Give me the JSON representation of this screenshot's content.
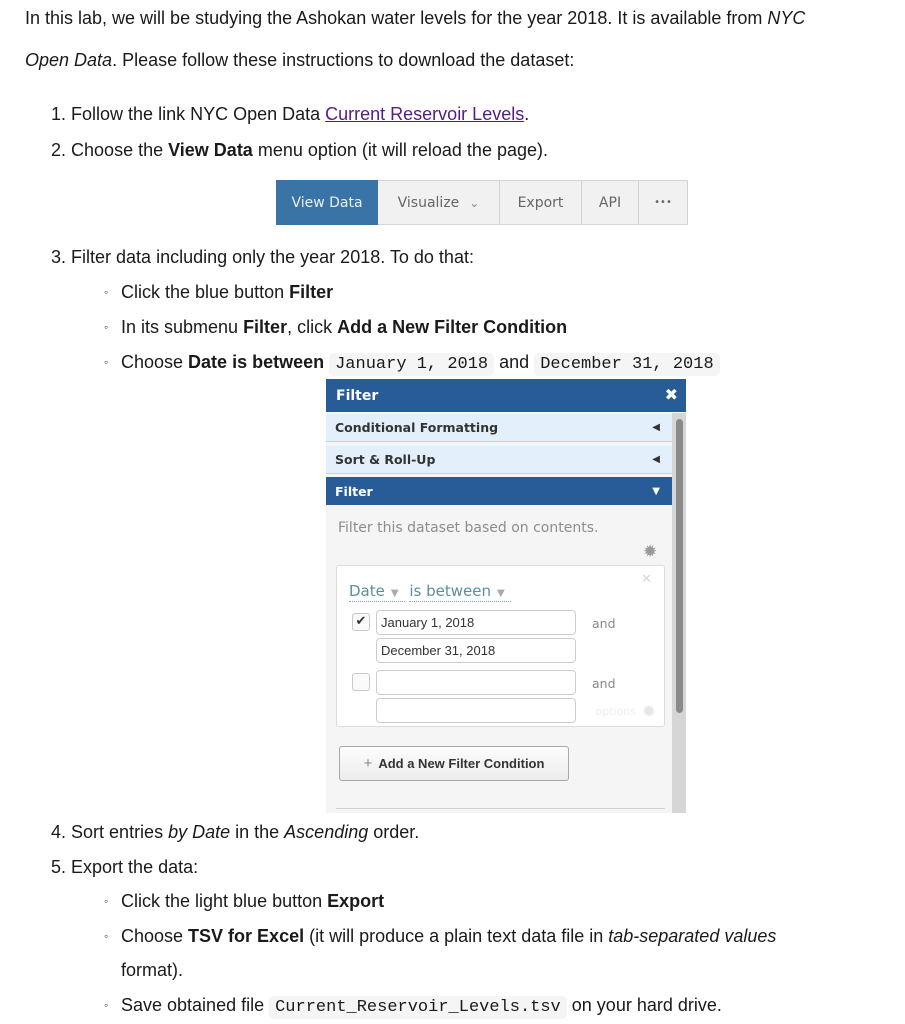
{
  "intro": {
    "line1_pre": "In this lab, we will be studying the Ashokan water levels for the year 2018. It is available from ",
    "line1_em": "NYC",
    "line2_em": "Open Data",
    "line2_post": ". Please follow these instructions to download the dataset:"
  },
  "steps": [
    {
      "num": "1.",
      "pre": "Follow the link NYC Open Data ",
      "link": "Current Reservoir Levels",
      "post": "."
    },
    {
      "num": "2.",
      "pre": "Choose the ",
      "bold": "View Data",
      "post": " menu option (it will reload the page)."
    },
    {
      "num": "3.",
      "text": "Filter data including only the year 2018. To do that:",
      "sub": [
        {
          "pre": "Click the blue button ",
          "bold": "Filter"
        },
        {
          "pre": "In its submenu ",
          "bold": "Filter",
          "mid": ", click ",
          "bold2": "Add a New Filter Condition"
        },
        {
          "pre": "Choose ",
          "bold": "Date is between",
          "code1": "January 1, 2018",
          "mid": "and",
          "code2": "December 31, 2018"
        }
      ]
    },
    {
      "num": "4.",
      "pre": "Sort entries ",
      "em1": "by Date",
      "mid": " in the ",
      "em2": "Ascending",
      "post": " order."
    },
    {
      "num": "5.",
      "text": "Export the data:",
      "sub": [
        {
          "pre": "Click the light blue button ",
          "bold": "Export"
        },
        {
          "pre": "Choose ",
          "bold": "TSV for Excel",
          "mid": " (it will produce a plain text data file in ",
          "em": "tab-separated values",
          "cont": "format)."
        },
        {
          "pre": "Save obtained file ",
          "code": "Current_Reservoir_Levels.tsv",
          "post": "on your hard drive."
        }
      ]
    }
  ],
  "toolbar": {
    "items": [
      "View Data",
      "Visualize",
      "Export",
      "API",
      "•••"
    ],
    "active": "View Data",
    "active_color": "#3a74a6"
  },
  "filter_panel": {
    "title": "Filter",
    "sections": [
      {
        "label": "Conditional Formatting",
        "state": "collapsed"
      },
      {
        "label": "Sort & Roll-Up",
        "state": "collapsed"
      },
      {
        "label": "Filter",
        "state": "expanded"
      }
    ],
    "description": "Filter this dataset based on contents.",
    "condition": {
      "column": "Date",
      "operator": "is between",
      "rows": [
        {
          "checked": true,
          "from": "January 1, 2018",
          "to": "December 31, 2018",
          "joiner": "and"
        },
        {
          "checked": false,
          "from": "",
          "to": "",
          "joiner": "and"
        }
      ],
      "options_label": "options"
    },
    "add_button": "Add a New Filter Condition",
    "header_color": "#285c99"
  }
}
